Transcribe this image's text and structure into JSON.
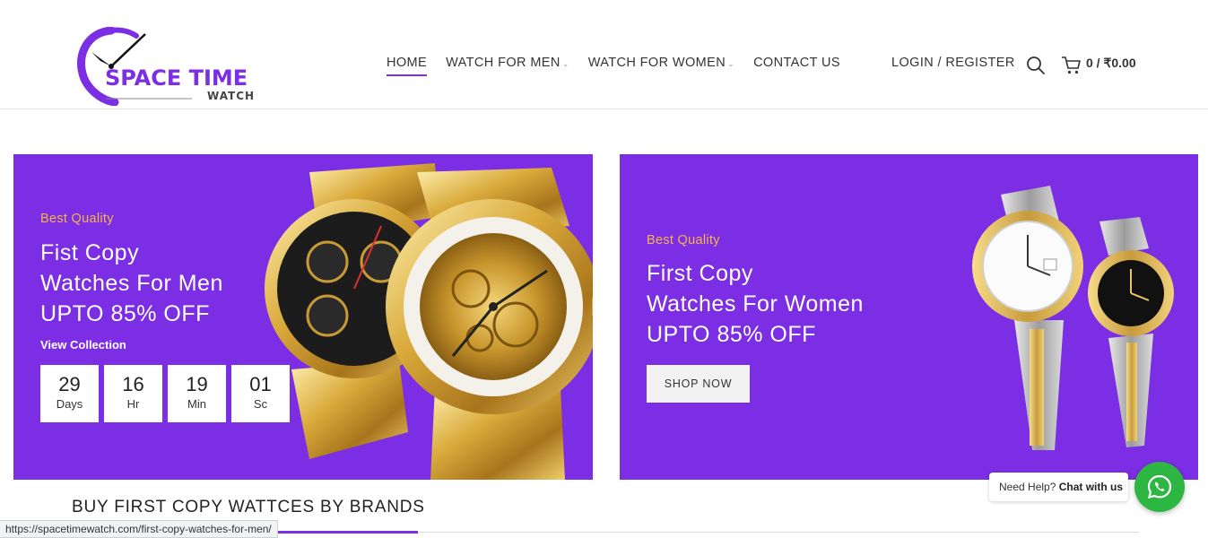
{
  "brand": {
    "name_line1": "SPACE TIME",
    "name_line2": "WATCH",
    "accent_color": "#7b2ee3"
  },
  "nav": {
    "items": [
      {
        "label": "HOME",
        "active": true,
        "has_dropdown": false
      },
      {
        "label": "WATCH FOR MEN",
        "active": false,
        "has_dropdown": true
      },
      {
        "label": "WATCH FOR WOMEN",
        "active": false,
        "has_dropdown": true
      },
      {
        "label": "CONTACT US",
        "active": false,
        "has_dropdown": false
      }
    ],
    "login_label": "LOGIN / REGISTER",
    "search_icon": "search-icon",
    "cart_icon": "cart-icon",
    "cart_text": "0 / ₹0.00"
  },
  "banner_men": {
    "tag": "Best Quality",
    "line1": "Fist Copy",
    "line2": "Watches For Men",
    "line3": "UPTO 85% OFF",
    "link": "View Collection",
    "countdown": [
      {
        "value": "29",
        "label": "Days"
      },
      {
        "value": "16",
        "label": "Hr"
      },
      {
        "value": "19",
        "label": "Min"
      },
      {
        "value": "01",
        "label": "Sc"
      }
    ],
    "background": "#7b2ee3",
    "tag_color": "#f7b44a"
  },
  "banner_women": {
    "tag": "Best Quality",
    "line1": "First Copy",
    "line2": "Watches For Women",
    "line3": "UPTO 85% OFF",
    "button": "SHOP NOW"
  },
  "section": {
    "title": "BUY FIRST COPY WATTCES BY BRANDS"
  },
  "status_url": "https://spacetimewatch.com/first-copy-watches-for-men/",
  "chat": {
    "prefix": "Need Help?",
    "action": "Chat with us",
    "icon": "whatsapp-icon",
    "color": "#2db742"
  }
}
